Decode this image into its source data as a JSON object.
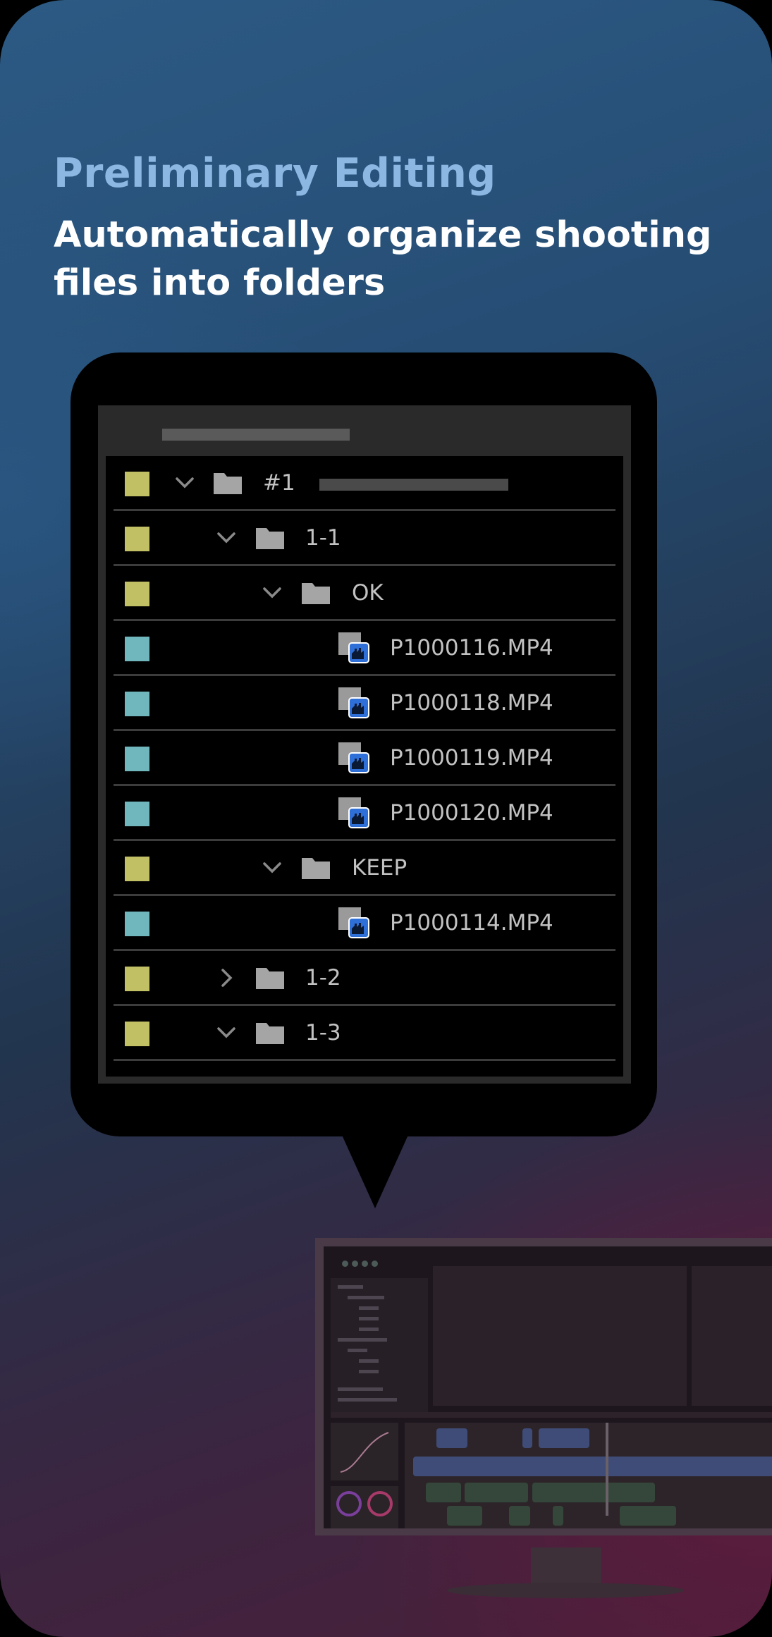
{
  "headline": {
    "kicker": "Preliminary Editing",
    "subtitle": "Automatically organize shooting files into folders"
  },
  "colors": {
    "folder_label": "#c2c064",
    "clip_label": "#6fb6bd",
    "kicker": "#8cb7e3"
  },
  "tree": {
    "rows": [
      {
        "type": "folder",
        "label": "#1",
        "expanded": true
      },
      {
        "type": "folder",
        "label": "1-1",
        "expanded": true
      },
      {
        "type": "folder",
        "label": "OK",
        "expanded": true
      },
      {
        "type": "clip",
        "label": "P1000116.MP4"
      },
      {
        "type": "clip",
        "label": "P1000118.MP4"
      },
      {
        "type": "clip",
        "label": "P1000119.MP4"
      },
      {
        "type": "clip",
        "label": "P1000120.MP4"
      },
      {
        "type": "folder",
        "label": "KEEP",
        "expanded": true
      },
      {
        "type": "clip",
        "label": "P1000114.MP4"
      },
      {
        "type": "folder",
        "label": "1-2",
        "expanded": false
      },
      {
        "type": "folder",
        "label": "1-3",
        "expanded": true
      }
    ]
  },
  "icons": {
    "chevron_expanded": "chevron-down-icon",
    "chevron_collapsed": "chevron-right-icon",
    "folder": "folder-icon",
    "clip": "video-clip-icon"
  }
}
